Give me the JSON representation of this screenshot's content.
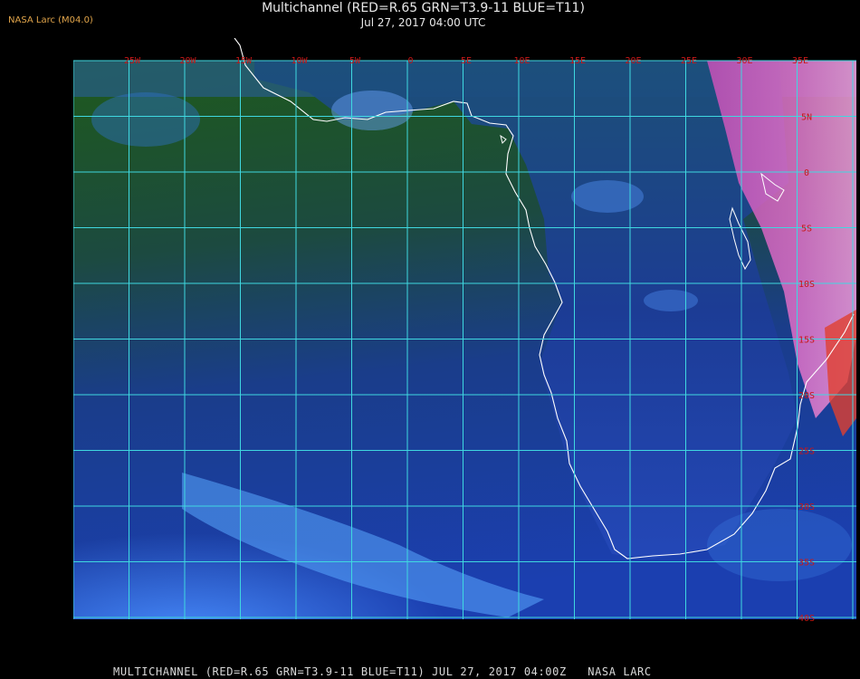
{
  "header": {
    "source_label": "NASA Larc (M04.0)",
    "title": "Multichannel (RED=R.65 GRN=T3.9-11 BLUE=T11)",
    "datetime": "Jul 27, 2017 04:00 UTC"
  },
  "map": {
    "longitude_labels": [
      "25W",
      "20W",
      "15W",
      "10W",
      "5W",
      "0",
      "5E",
      "10E",
      "15E",
      "20E",
      "25E",
      "30E",
      "35E"
    ],
    "latitude_labels": [
      "5N",
      "0",
      "5S",
      "10S",
      "15S",
      "20S",
      "25S",
      "30S",
      "35S",
      "40S"
    ],
    "colors": {
      "grid": "#3fd8e0",
      "coastline": "#ffffff",
      "label": "#c81818",
      "ocean_north": "#1f5a1e",
      "ocean_south": "#1838a8",
      "cloud": "#5aa0ff",
      "land_highland": "#d060c0"
    }
  },
  "footer": {
    "caption": "MULTICHANNEL (RED=R.65 GRN=T3.9-11 BLUE=T11) JUL 27, 2017 04:00Z   NASA LARC"
  }
}
